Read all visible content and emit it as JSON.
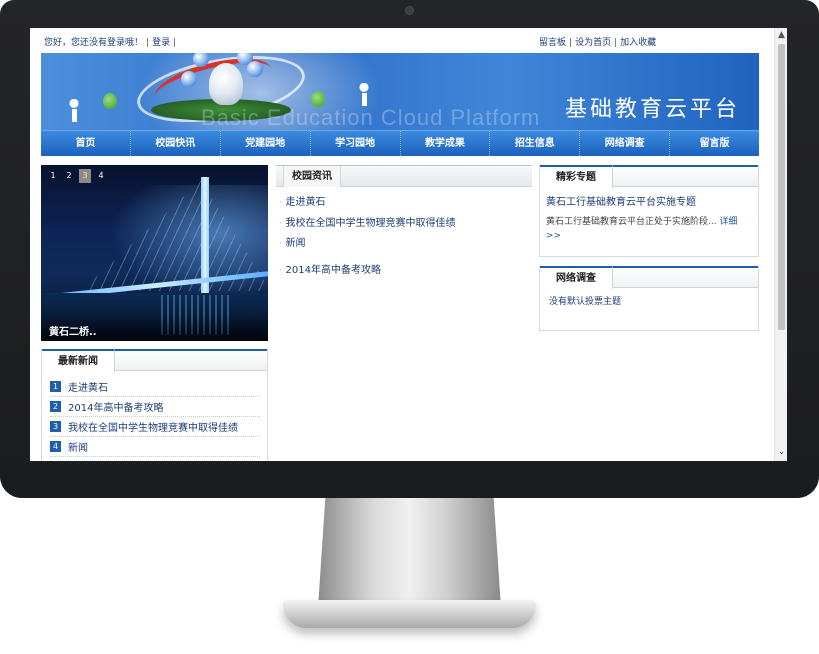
{
  "topbar": {
    "greeting": "您好，您还没有登录哦！",
    "login": "登录",
    "guestbook": "留言板",
    "set_home": "设为首页",
    "favorite": "加入收藏"
  },
  "banner": {
    "title": "基础教育云平台",
    "subtitle": "Basic Education Cloud Platform"
  },
  "nav": {
    "items": [
      "首页",
      "校园快讯",
      "党建园地",
      "学习园地",
      "教学成果",
      "招生信息",
      "网络调查",
      "留言版"
    ]
  },
  "slider": {
    "pages": [
      "1",
      "2",
      "3",
      "4"
    ],
    "active_page": "3",
    "caption": "黄石二桥.."
  },
  "latest_news": {
    "title": "最新新闻",
    "items": [
      {
        "num": "1",
        "text": "走进黄石"
      },
      {
        "num": "2",
        "text": "2014年高中备考攻略"
      },
      {
        "num": "3",
        "text": "我校在全国中学生物理竞赛中取得佳绩"
      },
      {
        "num": "4",
        "text": "新闻"
      }
    ]
  },
  "campus_news": {
    "title": "校园资讯",
    "items": [
      "走进黄石",
      "我校在全国中学生物理竞赛中取得佳绩",
      "新闻",
      "2014年高中备考攻略"
    ]
  },
  "featured": {
    "title": "精彩专题",
    "link": "黄石工行基础教育云平台实施专题",
    "desc": "黄石工行基础教育云平台正处于实施阶段...",
    "more": "详细>>"
  },
  "survey": {
    "title": "网络调查",
    "empty_text": "没有默认投票主题"
  },
  "colors": {
    "nav_blue": "#1c61bc",
    "link_blue": "#1e3c77",
    "frame": "#1c1d20"
  }
}
